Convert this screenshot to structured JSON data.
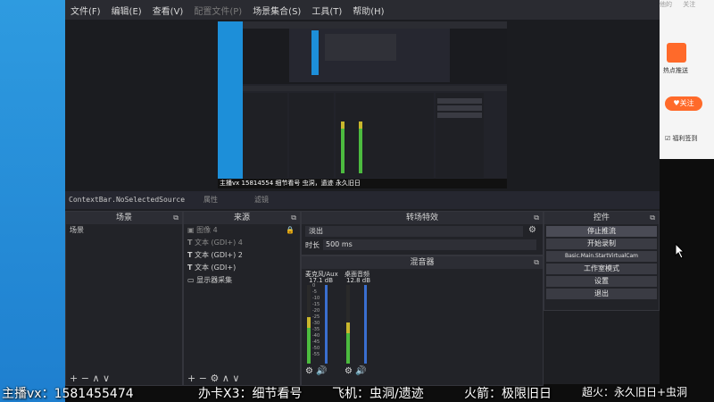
{
  "menu": [
    "文件(F)",
    "编辑(E)",
    "查看(V)",
    "配置文件(P)",
    "场景集合(S)",
    "工具(T)",
    "帮助(H)"
  ],
  "preview_text": {
    "streamer_label": "主播vx",
    "number": "15814554",
    "detail": "细节看号",
    "plane_fragment": "虫洞，遗迹",
    "rocket_fragment": "永久旧日"
  },
  "status_line": {
    "context": "ContextBar.NoSelectedSource",
    "props": "属性",
    "filters": "滤镜"
  },
  "docks": {
    "scenes": {
      "title": "场景",
      "items": [
        "场景"
      ]
    },
    "sources": {
      "title": "来源",
      "items": [
        {
          "name": "图像 4",
          "icon": "image-icon",
          "visible": false
        },
        {
          "name": "文本 (GDI+) 4",
          "icon": "text-icon",
          "visible": false
        },
        {
          "name": "文本 (GDI+) 2",
          "icon": "text-icon",
          "visible": true
        },
        {
          "name": "文本 (GDI+)",
          "icon": "text-icon",
          "visible": true
        },
        {
          "name": "显示器采集",
          "icon": "monitor-icon",
          "visible": true
        }
      ]
    },
    "transitions": {
      "title": "转场特效",
      "type": "淡出",
      "duration_label": "时长",
      "duration": "500 ms"
    },
    "mixer": {
      "title": "混音器",
      "channels": [
        {
          "name": "麦克风/Aux",
          "db": "17.1 dB",
          "level": 0.55
        },
        {
          "name": "桌面音频",
          "db": "12.8 dB",
          "level": 0.45
        }
      ],
      "scale": [
        "0",
        "-5",
        "-10",
        "-15",
        "-20",
        "-25",
        "-30",
        "-35",
        "-40",
        "-45",
        "-50",
        "-55",
        "-60"
      ]
    },
    "controls": {
      "title": "控件",
      "buttons": [
        "停止推流",
        "开始录制",
        "Basic.Main.StartVirtualCam",
        "工作室模式",
        "设置",
        "退出"
      ]
    }
  },
  "right_panel": {
    "top_items": [
      "他的",
      "关注"
    ],
    "hot_label": "热点推送",
    "follow_button": "关注",
    "benefit_label": "福利签到"
  },
  "caption": {
    "part1": "主播vx：1581455474",
    "part2": "办卡X3：细节看号",
    "part3": "飞机：虫洞/遗迹",
    "part4": "火箭：极限旧日",
    "part5": "超火：永久旧日+虫洞"
  },
  "colors": {
    "obs_bg": "#1e1f23",
    "dock_title": "#2c2d34",
    "meter_green": "#4cbb3f",
    "meter_yellow": "#c9b72d",
    "meter_red": "#c53b3b",
    "follow_orange": "#ff6a2a",
    "desktop_blue": "#2e9be0"
  }
}
